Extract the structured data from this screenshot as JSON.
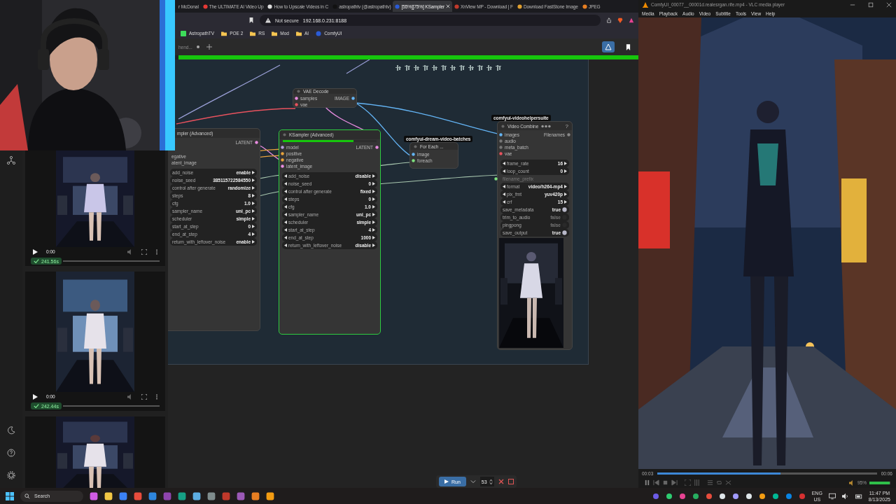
{
  "browser": {
    "tabs": [
      {
        "title": "r McDonal",
        "selected": false
      },
      {
        "title": "The ULTIMATE AI Video Up",
        "selected": false
      },
      {
        "title": "How to Upscale Videos in C",
        "selected": false
      },
      {
        "title": "astropathtv (@astropathtv)",
        "selected": false
      },
      {
        "title": "[55%][75%] KSampler",
        "selected": true
      },
      {
        "title": "XnView MP - Download | F",
        "selected": false
      },
      {
        "title": "Download FastStone Image",
        "selected": false
      },
      {
        "title": "JPEG",
        "selected": false
      }
    ],
    "address": {
      "security": "Not secure",
      "url": "192.168.0.231:8188"
    },
    "bookmarks": [
      "AstropathTV",
      "POE 2",
      "RS",
      "Mod",
      "AI",
      "ComfyUI"
    ]
  },
  "comfy": {
    "workflow_tab": {
      "title": "hend...",
      "modified": true
    },
    "progress": {
      "level": 1
    },
    "queue": [
      {
        "kind": "video",
        "time": "0:00",
        "duration": "241.56s"
      },
      {
        "kind": "video",
        "time": "0:00",
        "duration": "242.44s"
      },
      {
        "kind": "preview"
      }
    ],
    "nodes": [
      {
        "title": "mpler (Advanced)",
        "running": false,
        "inputs": [
          {
            "label": "egative"
          },
          {
            "label": "atent_image"
          }
        ],
        "outputs": [
          {
            "label": "LATENT",
            "color": "#e88ce0"
          }
        ],
        "widgets": [
          {
            "kind": "combo",
            "label": "add_noise",
            "value": "enable"
          },
          {
            "kind": "combo",
            "label": "noise_seed",
            "value": "385115722584550"
          },
          {
            "kind": "combo",
            "label": "control after generate",
            "value": "randomize"
          },
          {
            "kind": "combo",
            "label": "steps",
            "value": "8"
          },
          {
            "kind": "combo",
            "label": "cfg",
            "value": "1.0"
          },
          {
            "kind": "combo",
            "label": "sampler_name",
            "value": "uni_pc"
          },
          {
            "kind": "combo",
            "label": "scheduler",
            "value": "simple"
          },
          {
            "kind": "combo",
            "label": "start_at_step",
            "value": "0"
          },
          {
            "kind": "combo",
            "label": "end_at_step",
            "value": "4"
          },
          {
            "kind": "combo",
            "label": "return_with_leftover_noise",
            "value": "enable"
          }
        ]
      },
      {
        "title": "VAE Decode",
        "running": false,
        "inputs": [
          {
            "label": "samples",
            "color": "#e88ce0"
          },
          {
            "label": "vae",
            "color": "#e8525e"
          }
        ],
        "outputs": [
          {
            "label": "IMAGE",
            "color": "#64b5f6"
          }
        ]
      },
      {
        "title": "KSampler (Advanced)",
        "running": true,
        "progress": {
          "level": 0.75
        },
        "inputs": [
          {
            "label": "model",
            "color": "#b39ddb"
          },
          {
            "label": "positive",
            "color": "#e8a33c"
          },
          {
            "label": "negative",
            "color": "#e8a33c"
          },
          {
            "label": "latent_image",
            "color": "#e88ce0"
          }
        ],
        "outputs": [
          {
            "label": "LATENT",
            "color": "#e88ce0"
          }
        ],
        "widgets": [
          {
            "kind": "combo",
            "label": "add_noise",
            "value": "disable"
          },
          {
            "kind": "combo",
            "label": "noise_seed",
            "value": "0"
          },
          {
            "kind": "combo",
            "label": "control after generate",
            "value": "fixed"
          },
          {
            "kind": "combo",
            "label": "steps",
            "value": "0"
          },
          {
            "kind": "combo",
            "label": "cfg",
            "value": "1.0"
          },
          {
            "kind": "combo",
            "label": "sampler_name",
            "value": "uni_pc"
          },
          {
            "kind": "combo",
            "label": "scheduler",
            "value": "simple"
          },
          {
            "kind": "combo",
            "label": "start_at_step",
            "value": "4"
          },
          {
            "kind": "combo",
            "label": "end_at_step",
            "value": "1000"
          },
          {
            "kind": "combo",
            "label": "return_with_leftover_noise",
            "value": "disable"
          }
        ]
      },
      {
        "title": "For Each ...",
        "running": false,
        "badge": "comfyui-dream-video-batches",
        "inputs": [
          {
            "label": "image",
            "color": "#64b5f6"
          },
          {
            "label": "foreach",
            "color": "#7ee07e"
          }
        ]
      },
      {
        "title": "Video Combine",
        "running": false,
        "badge": "comfyui-videohelpersuite",
        "help": "?",
        "inputs": [
          {
            "label": "images",
            "color": "#64b5f6"
          },
          {
            "label": "audio",
            "color": "#777777"
          },
          {
            "label": "meta_batch",
            "color": "#777777"
          },
          {
            "label": "vae",
            "color": "#e8525e"
          }
        ],
        "outputs": [
          {
            "label": "Filenames",
            "color": "#888888"
          }
        ],
        "widgets": [
          {
            "kind": "combo",
            "label": "frame_rate",
            "value": "16"
          },
          {
            "kind": "combo",
            "label": "loop_count",
            "value": "0"
          },
          {
            "kind": "input",
            "label": "filename_prefix"
          },
          {
            "kind": "combo",
            "label": "format",
            "value": "video/h264-mp4"
          },
          {
            "kind": "combo",
            "label": "pix_fmt",
            "value": "yuv420p"
          },
          {
            "kind": "combo",
            "label": "crf",
            "value": "15"
          },
          {
            "kind": "toggle",
            "label": "save_metadata",
            "value": "true",
            "on": true
          },
          {
            "kind": "toggle",
            "label": "trim_to_audio",
            "value": "false",
            "on": false
          },
          {
            "kind": "toggle",
            "label": "pingpong",
            "value": "false",
            "on": false
          },
          {
            "kind": "toggle",
            "label": "save_output",
            "value": "true",
            "on": true
          }
        ],
        "preview": {
          "kind": "picture"
        }
      }
    ],
    "run": {
      "label": "Run",
      "batch": "53"
    }
  },
  "vlc": {
    "title": "ComfyUI_00077__00001d.realesrgan.rife.mp4 - VLC media player",
    "menu": [
      "Media",
      "Playback",
      "Audio",
      "Video",
      "Subtitle",
      "Tools",
      "View",
      "Help"
    ],
    "elapsed": "00:03",
    "total": "00:06",
    "seek": {
      "level": 0.56
    },
    "volume": {
      "level": 0.95,
      "reading": "95%"
    }
  },
  "taskbar": {
    "search": "Search",
    "language": "ENG",
    "region": "US",
    "time": "11:47 PM",
    "date": "8/13/2025"
  }
}
